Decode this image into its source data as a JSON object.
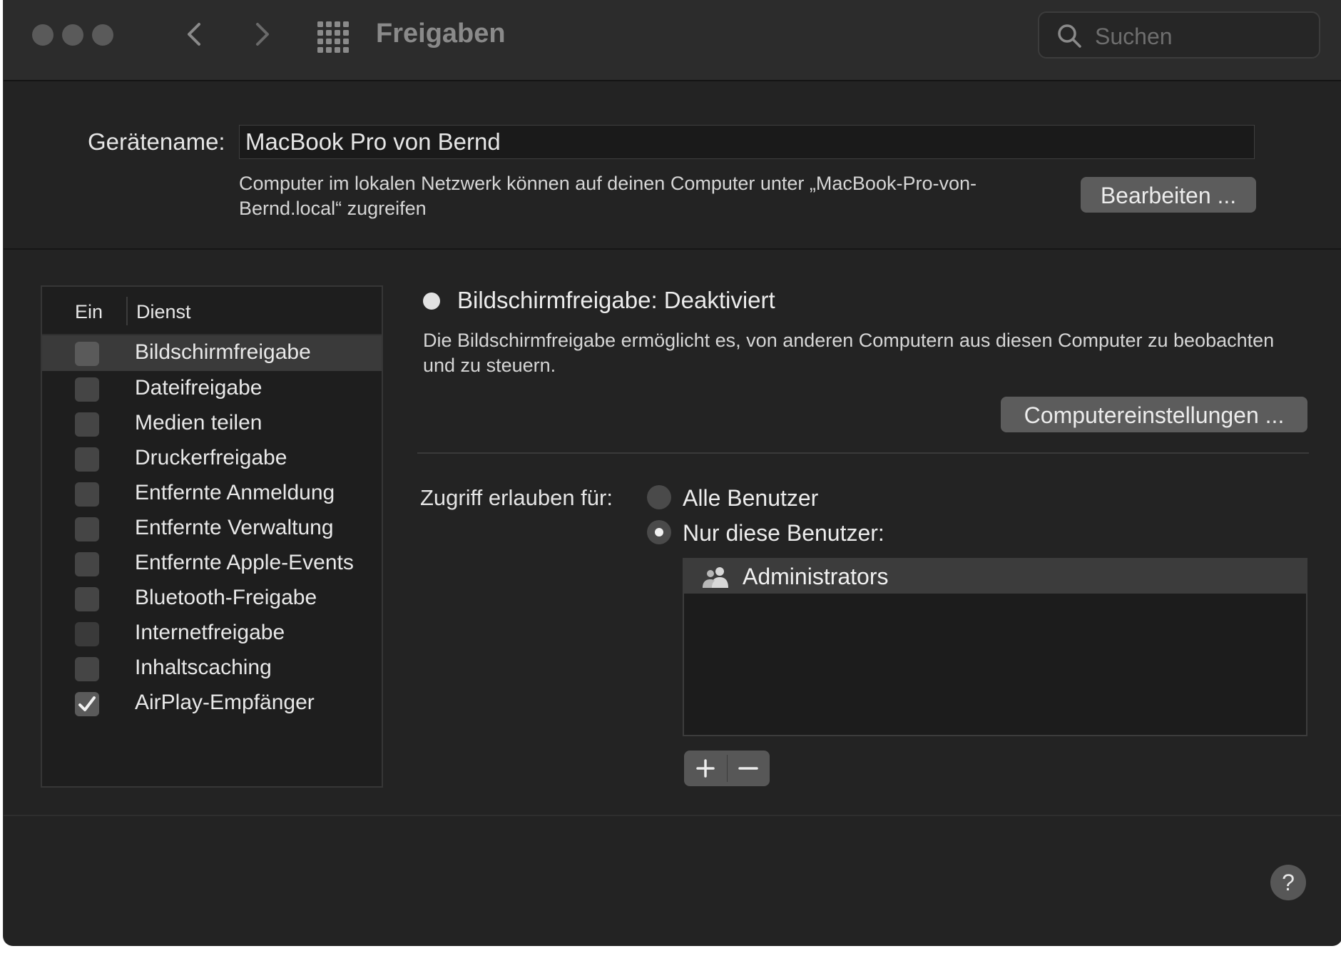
{
  "window": {
    "title": "Freigaben"
  },
  "search": {
    "placeholder": "Suchen"
  },
  "device": {
    "label": "Gerätename:",
    "value": "MacBook Pro von Bernd",
    "description": "Computer im lokalen Netzwerk können auf deinen Computer unter „MacBook-Pro-von-Bernd.local“ zugreifen",
    "edit_button": "Bearbeiten ..."
  },
  "services": {
    "col_on": "Ein",
    "col_service": "Dienst",
    "items": [
      {
        "label": "Bildschirmfreigabe",
        "checked": false,
        "selected": true
      },
      {
        "label": "Dateifreigabe",
        "checked": false
      },
      {
        "label": "Medien teilen",
        "checked": false
      },
      {
        "label": "Druckerfreigabe",
        "checked": false
      },
      {
        "label": "Entfernte Anmeldung",
        "checked": false
      },
      {
        "label": "Entfernte Verwaltung",
        "checked": false
      },
      {
        "label": "Entfernte Apple-Events",
        "checked": false
      },
      {
        "label": "Bluetooth-Freigabe",
        "checked": false
      },
      {
        "label": "Internetfreigabe",
        "checked": false
      },
      {
        "label": "Inhaltscaching",
        "checked": false
      },
      {
        "label": "AirPlay-Empfänger",
        "checked": true
      }
    ]
  },
  "detail": {
    "status": "Bildschirmfreigabe: Deaktiviert",
    "description": "Die Bildschirmfreigabe ermöglicht es, von anderen Computern aus diesen Computer zu beobachten und zu steuern.",
    "computer_settings_button": "Computereinstellungen ...",
    "access_label": "Zugriff erlauben für:",
    "access_options": [
      {
        "label": "Alle Benutzer",
        "selected": false
      },
      {
        "label": "Nur diese Benutzer:",
        "selected": true
      }
    ],
    "users": [
      {
        "name": "Administrators",
        "icon": "user-group-icon"
      }
    ],
    "add_icon": "plus-icon",
    "remove_icon": "minus-icon"
  },
  "help": {
    "label": "?"
  }
}
